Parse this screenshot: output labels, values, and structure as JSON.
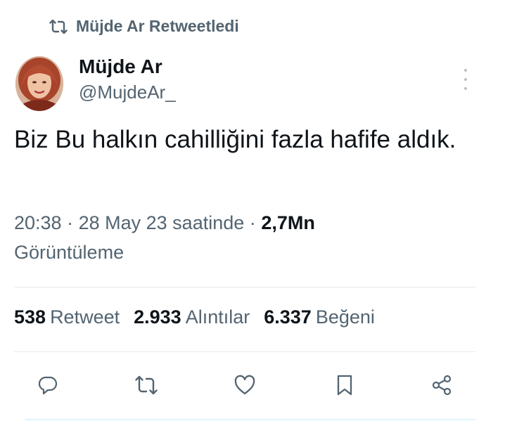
{
  "retweet_context": {
    "label": "Müjde Ar Retweetledi",
    "icon": "retweet-icon"
  },
  "author": {
    "display_name": "Müjde Ar",
    "handle": "@MujdeAr_",
    "avatar": "profile-photo"
  },
  "tweet": {
    "text": "Biz Bu halkın cahilliğini fazla hafife aldık."
  },
  "meta": {
    "time": "20:38",
    "separator": "·",
    "date": "28 May 23 saatinde",
    "views_count": "2,7Mn",
    "views_label": "Görüntüleme"
  },
  "stats": {
    "retweets": {
      "count": "538",
      "label": "Retweet"
    },
    "quotes": {
      "count": "2.933",
      "label": "Alıntılar"
    },
    "likes": {
      "count": "6.337",
      "label": "Beğeni"
    }
  },
  "actions": [
    {
      "name": "reply",
      "icon": "reply-icon"
    },
    {
      "name": "retweet",
      "icon": "retweet-icon"
    },
    {
      "name": "like",
      "icon": "heart-icon"
    },
    {
      "name": "bookmark",
      "icon": "bookmark-icon"
    },
    {
      "name": "share",
      "icon": "share-icon"
    }
  ],
  "colors": {
    "text_primary": "#0f1419",
    "text_secondary": "#536471",
    "divider": "#e6e9eb"
  }
}
